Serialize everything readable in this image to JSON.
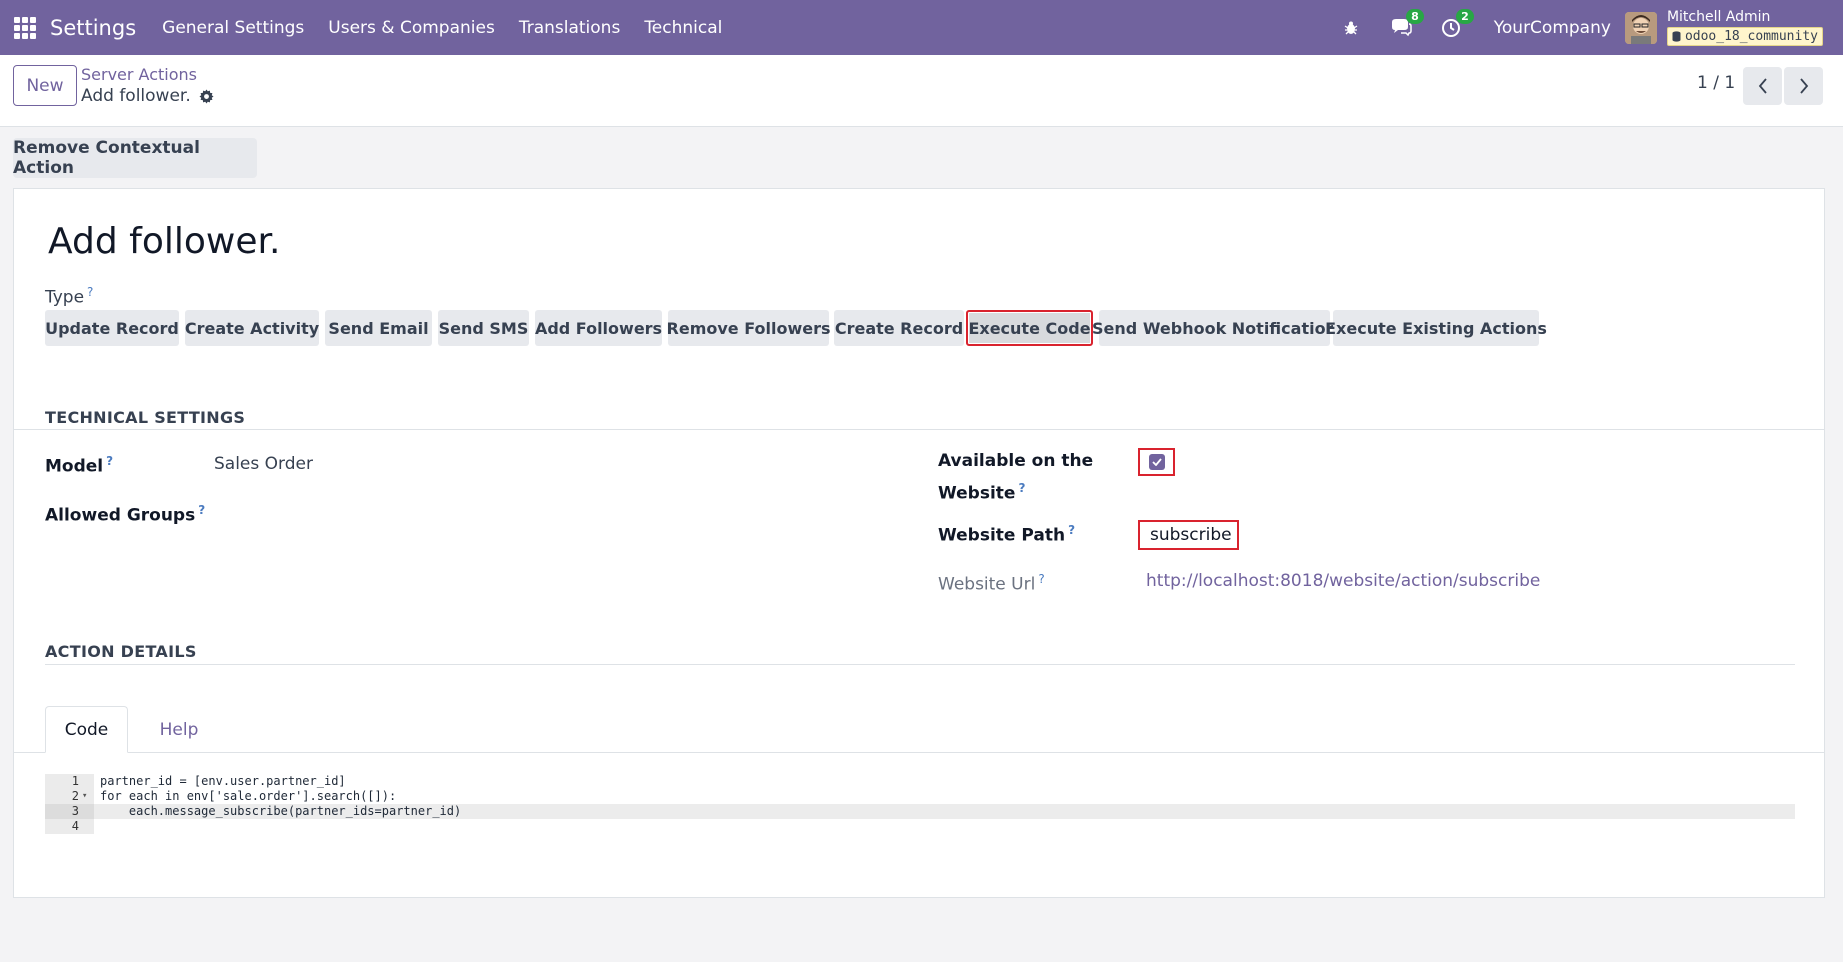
{
  "navbar": {
    "app_name": "Settings",
    "menu": [
      "General Settings",
      "Users & Companies",
      "Translations",
      "Technical"
    ],
    "messages_count": "8",
    "activities_count": "2",
    "company": "YourCompany",
    "user_name": "Mitchell Admin",
    "database": "odoo_18_community",
    "accent_color": "#71639e"
  },
  "control_panel": {
    "new_label": "New",
    "breadcrumb_parent": "Server Actions",
    "breadcrumb_current": "Add follower.",
    "pager": "1 / 1"
  },
  "actions": {
    "remove_contextual": "Remove Contextual Action"
  },
  "form": {
    "title": "Add follower.",
    "type_label": "Type",
    "help_mark": "?",
    "types": [
      "Update Record",
      "Create Activity",
      "Send Email",
      "Send SMS",
      "Add Followers",
      "Remove Followers",
      "Create Record",
      "Execute Code",
      "Send Webhook Notification",
      "Execute Existing Actions"
    ],
    "selected_type": "Execute Code",
    "technical_settings": {
      "heading": "TECHNICAL SETTINGS",
      "model_label": "Model",
      "model_value": "Sales Order",
      "allowed_groups_label": "Allowed Groups",
      "website_label_line1": "Available on the",
      "website_label_line2": "Website",
      "website_checked": true,
      "website_path_label": "Website Path",
      "website_path_value": "subscribe",
      "website_url_label": "Website Url",
      "website_url_value": "http://localhost:8018/website/action/subscribe"
    },
    "action_details": {
      "heading": "ACTION DETAILS",
      "tabs": [
        "Code",
        "Help"
      ],
      "active_tab": "Code"
    },
    "code_lines": [
      {
        "n": "1",
        "text": "partner_id = [env.user.partner_id]"
      },
      {
        "n": "2",
        "text": "for each in env['sale.order'].search([]):"
      },
      {
        "n": "3",
        "text": "    each.message_subscribe(partner_ids=partner_id)"
      },
      {
        "n": "4",
        "text": ""
      }
    ]
  }
}
